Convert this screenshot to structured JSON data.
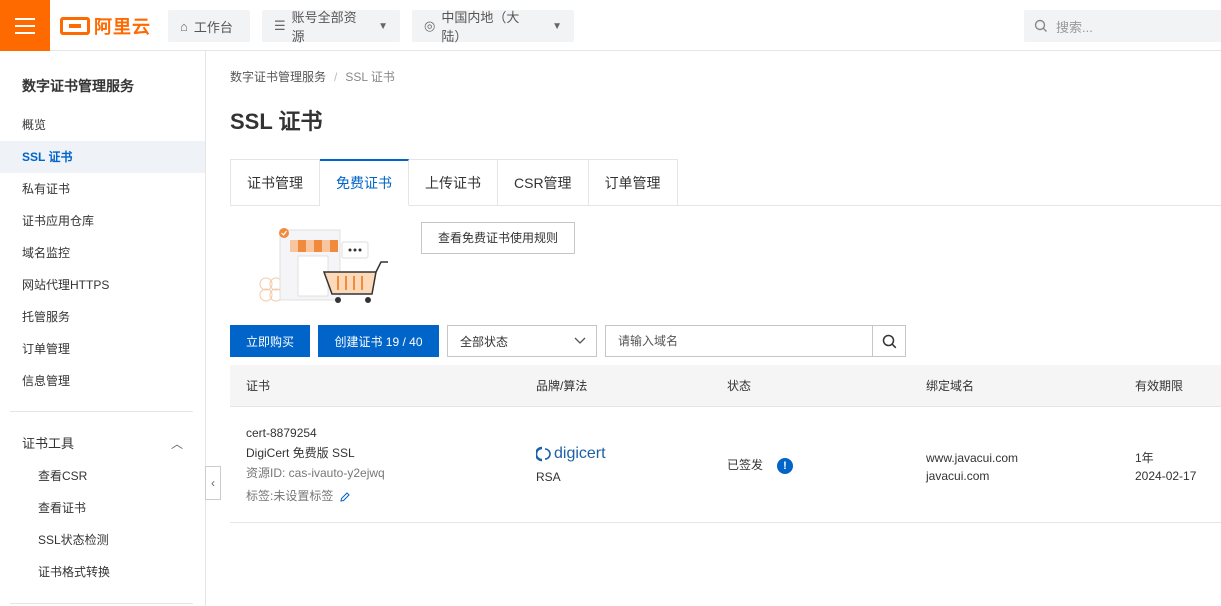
{
  "header": {
    "logo_text": "阿里云",
    "workbench": "工作台",
    "account_scope": "账号全部资源",
    "region": "中国内地（大陆）",
    "search_placeholder": "搜索..."
  },
  "sidebar": {
    "title": "数字证书管理服务",
    "items": [
      {
        "label": "概览"
      },
      {
        "label": "SSL 证书"
      },
      {
        "label": "私有证书"
      },
      {
        "label": "证书应用仓库"
      },
      {
        "label": "域名监控"
      },
      {
        "label": "网站代理HTTPS"
      },
      {
        "label": "托管服务"
      },
      {
        "label": "订单管理"
      },
      {
        "label": "信息管理"
      }
    ],
    "group_title": "证书工具",
    "sub_items": [
      {
        "label": "查看CSR"
      },
      {
        "label": "查看证书"
      },
      {
        "label": "SSL状态检测"
      },
      {
        "label": "证书格式转换"
      }
    ]
  },
  "breadcrumb": {
    "root": "数字证书管理服务",
    "current": "SSL 证书"
  },
  "page_title": "SSL 证书",
  "tabs": [
    {
      "label": "证书管理"
    },
    {
      "label": "免费证书"
    },
    {
      "label": "上传证书"
    },
    {
      "label": "CSR管理"
    },
    {
      "label": "订单管理"
    }
  ],
  "rules_button": "查看免费证书使用规则",
  "toolbar": {
    "buy_label": "立即购买",
    "create_label": "创建证书 19 / 40",
    "status_selected": "全部状态",
    "domain_placeholder": "请输入域名"
  },
  "table": {
    "headers": [
      "证书",
      "品牌/算法",
      "状态",
      "绑定域名",
      "有效期限"
    ],
    "rows": [
      {
        "cert_id": "cert-8879254",
        "cert_name": "DigiCert 免费版 SSL",
        "resource_id": "资源ID: cas-ivauto-y2ejwq",
        "tags": "标签:未设置标签",
        "brand": "digicert",
        "algorithm": "RSA",
        "status": "已签发",
        "domain_1": "www.javacui.com",
        "domain_2": "javacui.com",
        "validity": "1年",
        "expiry": "2024-02-17"
      }
    ]
  },
  "colors": {
    "brand_orange": "#ff6a00",
    "primary_blue": "#0064c8"
  }
}
